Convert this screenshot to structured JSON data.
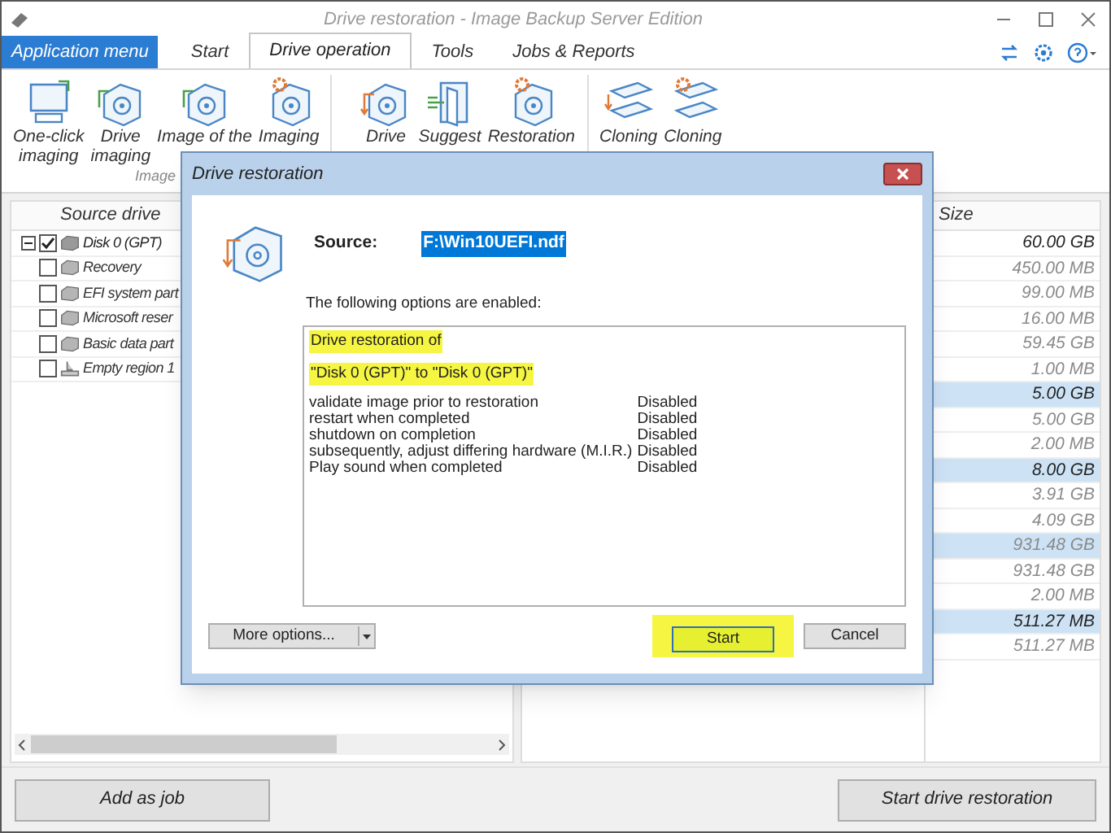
{
  "window": {
    "title": "Drive restoration - Image Backup Server Edition"
  },
  "tabs": [
    {
      "label": "Application menu",
      "kind": "app-menu",
      "selected": false
    },
    {
      "label": "Start",
      "kind": "tab",
      "selected": false
    },
    {
      "label": "Drive operation",
      "kind": "tab",
      "selected": true
    },
    {
      "label": "Tools",
      "kind": "tab",
      "selected": false
    },
    {
      "label": "Jobs & Reports",
      "kind": "tab",
      "selected": false
    }
  ],
  "ribbon": {
    "buttons": [
      {
        "kind": "monitor",
        "lines": [
          "One-click",
          "imaging"
        ]
      },
      {
        "kind": "disk-green",
        "lines": [
          "Drive",
          "imaging"
        ]
      },
      {
        "kind": "disk-green",
        "lines": [
          "Image of the"
        ]
      },
      {
        "kind": "disk-gear",
        "lines": [
          "Imaging"
        ]
      },
      {
        "kind": "disk-restore",
        "lines": [
          "Drive"
        ]
      },
      {
        "kind": "folder",
        "lines": [
          "Suggest"
        ]
      },
      {
        "kind": "disk-gear",
        "lines": [
          "Restoration"
        ]
      },
      {
        "kind": "clone",
        "lines": [
          "Cloning"
        ]
      },
      {
        "kind": "clone-gear",
        "lines": [
          "Cloning"
        ]
      }
    ],
    "group_label": "Image"
  },
  "source_tree": {
    "column": "Source drive",
    "items": [
      {
        "label": "Disk 0 (GPT)",
        "kind": "disk",
        "checked": true,
        "expanded": true,
        "children": [
          {
            "label": "Recovery",
            "kind": "partition",
            "checked": false
          },
          {
            "label": "EFI system part",
            "kind": "partition",
            "checked": false
          },
          {
            "label": "Microsoft reser",
            "kind": "partition",
            "checked": false
          },
          {
            "label": "Basic data part",
            "kind": "partition",
            "checked": false
          },
          {
            "label": "Empty region 1",
            "kind": "empty",
            "checked": false
          }
        ]
      }
    ]
  },
  "size_column": {
    "header": "Size",
    "rows": [
      {
        "value": "60.00 GB",
        "highlighted": false,
        "dimmed": false
      },
      {
        "value": "450.00 MB",
        "highlighted": false,
        "dimmed": true
      },
      {
        "value": "99.00 MB",
        "highlighted": false,
        "dimmed": true
      },
      {
        "value": "16.00 MB",
        "highlighted": false,
        "dimmed": true
      },
      {
        "value": "59.45 GB",
        "highlighted": false,
        "dimmed": true
      },
      {
        "value": "1.00 MB",
        "highlighted": false,
        "dimmed": true
      },
      {
        "value": "5.00 GB",
        "highlighted": true,
        "dimmed": false
      },
      {
        "value": "5.00 GB",
        "highlighted": false,
        "dimmed": true
      },
      {
        "value": "2.00 MB",
        "highlighted": false,
        "dimmed": true
      },
      {
        "value": "8.00 GB",
        "highlighted": true,
        "dimmed": false
      },
      {
        "value": "3.91 GB",
        "highlighted": false,
        "dimmed": true
      },
      {
        "value": "4.09 GB",
        "highlighted": false,
        "dimmed": true
      },
      {
        "value": "931.48 GB",
        "highlighted": true,
        "dimmed": true
      },
      {
        "value": "931.48 GB",
        "highlighted": false,
        "dimmed": true
      },
      {
        "value": "2.00 MB",
        "highlighted": false,
        "dimmed": true
      },
      {
        "value": "511.27 MB",
        "highlighted": true,
        "dimmed": false
      },
      {
        "value": "511.27 MB",
        "highlighted": false,
        "dimmed": true
      }
    ]
  },
  "dialog": {
    "title": "Drive restoration",
    "source_label": "Source:",
    "source_value": "F:\\Win10UEFI.ndf",
    "intro": "The following options are enabled:",
    "summary": [
      {
        "text": "Drive restoration of",
        "highlighted": true
      },
      {
        "text": "\"Disk 0 (GPT)\" to \"Disk 0 (GPT)\"",
        "highlighted": true
      }
    ],
    "options": [
      {
        "name": "validate image prior to restoration",
        "value": "Disabled"
      },
      {
        "name": "restart when completed",
        "value": "Disabled"
      },
      {
        "name": "shutdown on completion",
        "value": "Disabled"
      },
      {
        "name": "subsequently, adjust differing hardware (M.I.R.)",
        "value": "Disabled"
      },
      {
        "name": "Play sound when completed",
        "value": "Disabled"
      }
    ],
    "more_button": "More options...",
    "start_button": {
      "label": "Start",
      "highlighted": true
    },
    "cancel_button": "Cancel"
  },
  "bottom_buttons": [
    "Add as job",
    "Start drive restoration"
  ]
}
